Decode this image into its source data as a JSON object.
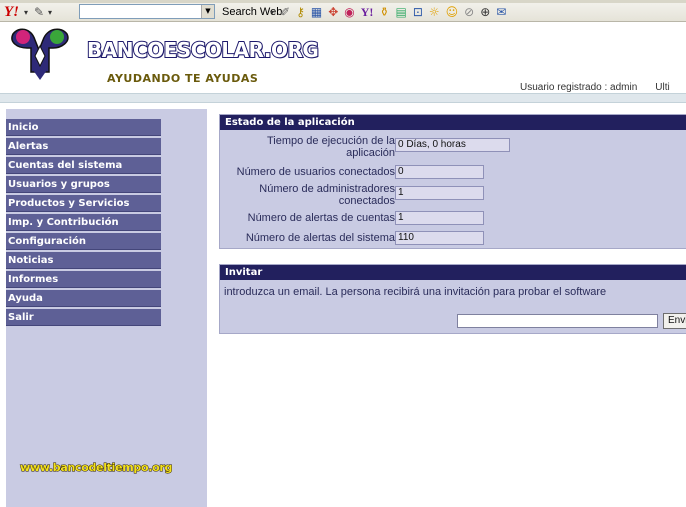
{
  "toolbar": {
    "yahoo_logo": "Y!",
    "search_value": "",
    "search_web_label": "Search Web",
    "icons": [
      "pencil-icon",
      "key-icon",
      "grid-icon",
      "crosshair-icon",
      "radio-icon",
      "yahoo-icon",
      "bookmark-icon",
      "calendar-icon",
      "shopping-icon",
      "smiley-icon",
      "link-icon",
      "globe-icon"
    ]
  },
  "header": {
    "site_name": "BANCOESCOLAR.ORG",
    "tagline": "AYUDANDO TE AYUDAS",
    "user_label": "Usuario registrado : admin",
    "user_extra": "Ulti",
    "colors": {
      "title_fill": "#ffffff",
      "title_outline": "#1e1a6c",
      "tagline": "#6a5a0c"
    }
  },
  "sidebar": {
    "items": [
      {
        "label": "Inicio"
      },
      {
        "label": "Alertas"
      },
      {
        "label": "Cuentas del sistema"
      },
      {
        "label": "Usuarios y grupos"
      },
      {
        "label": "Productos y Servicios"
      },
      {
        "label": "Imp. y Contribución"
      },
      {
        "label": "Configuración"
      },
      {
        "label": "Noticias"
      },
      {
        "label": "Informes"
      },
      {
        "label": "Ayuda"
      },
      {
        "label": "Salir"
      }
    ],
    "footer_link": "www.bancodeltiempo.org",
    "colors": {
      "menu_bg": "#5e6096",
      "panel_bg": "#c9cbe3",
      "footer": "#f2e11f"
    }
  },
  "status_panel": {
    "title": "Estado de la aplicación",
    "rows": [
      {
        "label_line1": "Tiempo de ejecución de la",
        "label_line2": "aplicación",
        "value": "0 Días, 0 horas"
      },
      {
        "label_line1": "Número de usuarios conectados",
        "label_line2": "",
        "value": "0"
      },
      {
        "label_line1": "Número de administradores",
        "label_line2": "conectados",
        "value": "1"
      },
      {
        "label_line1": "Número de alertas de cuentas",
        "label_line2": "",
        "value": "1"
      },
      {
        "label_line1": "Número de alertas del sistema",
        "label_line2": "",
        "value": "110"
      }
    ]
  },
  "invite_panel": {
    "title": "Invitar",
    "text": "introduzca un email. La persona recibirá una invitación para probar el software",
    "email_value": "",
    "button_label": "Enviar"
  }
}
